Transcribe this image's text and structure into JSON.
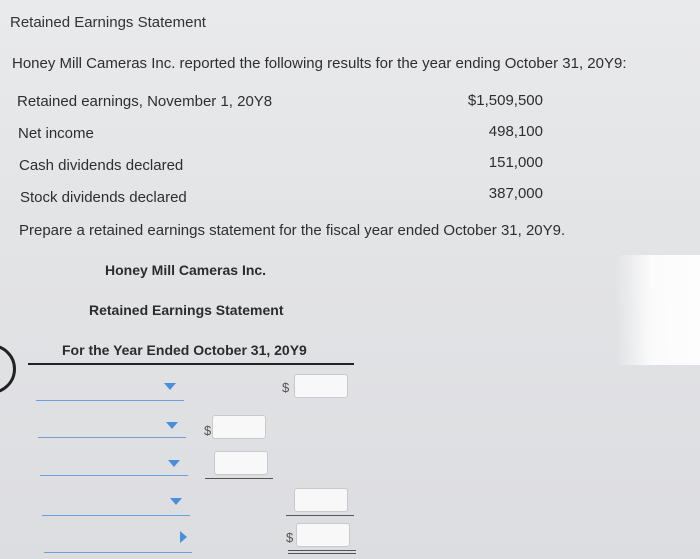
{
  "header": {
    "title": "Retained Earnings Statement",
    "intro": "Honey Mill Cameras Inc. reported the following results for the year ending October 31, 20Y9:"
  },
  "given_data": [
    {
      "label": "Retained earnings, November 1, 20Y8",
      "value": "$1,509,500"
    },
    {
      "label": "Net income",
      "value": "498,100"
    },
    {
      "label": "Cash dividends declared",
      "value": "151,000"
    },
    {
      "label": "Stock dividends declared",
      "value": "387,000"
    }
  ],
  "instruction": "Prepare a retained earnings statement for the fiscal year ended October 31, 20Y9.",
  "statement": {
    "company": "Honey Mill Cameras Inc.",
    "name": "Retained Earnings Statement",
    "period": "For the Year Ended October 31, 20Y9",
    "currency_symbol": "$"
  },
  "colors": {
    "dropdown_arrow": "#4a8fdc",
    "dropdown_line": "#6f9fd4"
  },
  "icons": [
    "dropdown-arrow-icon"
  ]
}
